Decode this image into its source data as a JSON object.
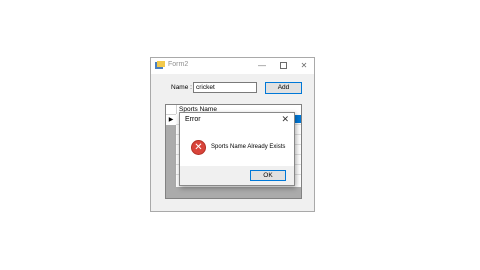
{
  "window": {
    "title": "Form2",
    "minimize_glyph": "—",
    "close_glyph": "✕"
  },
  "form": {
    "name_label": "Name :",
    "name_value": "cricket",
    "add_button": "Add"
  },
  "grid": {
    "column_header": "Sports Name",
    "current_row_glyph": "▶"
  },
  "dialog": {
    "title": "Error",
    "close_glyph": "✕",
    "icon": "error-icon",
    "icon_glyph": "✕",
    "message": "Sports Name Already Exists",
    "ok_button": "OK"
  }
}
